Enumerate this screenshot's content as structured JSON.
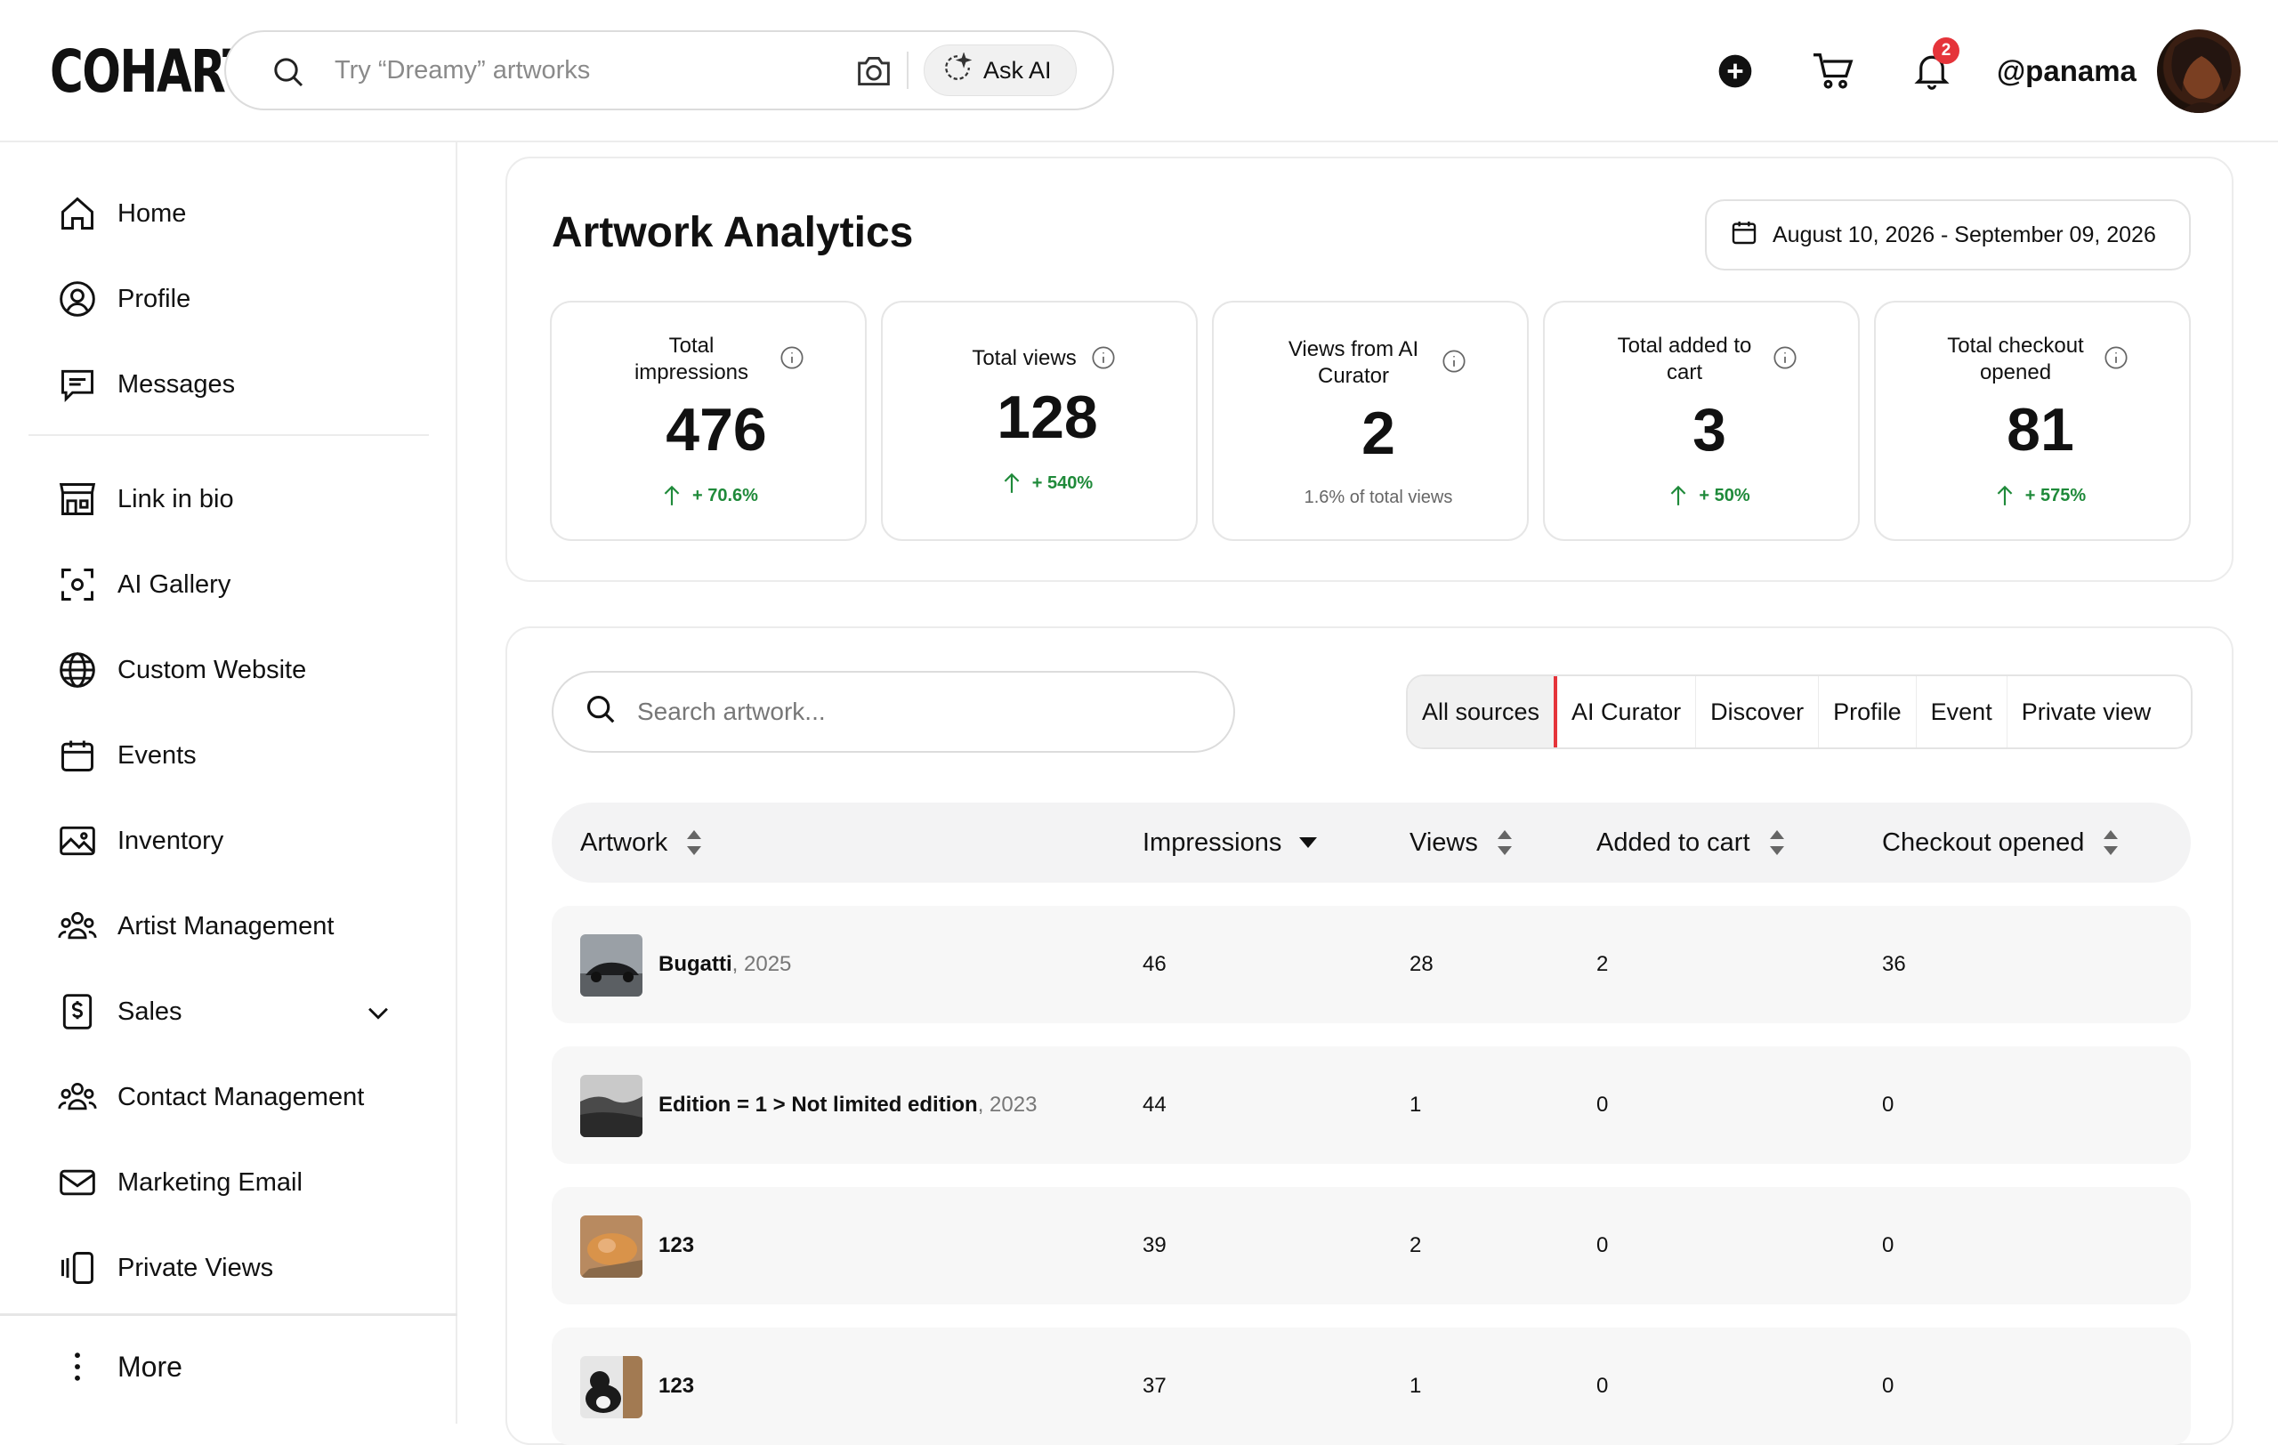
{
  "brand": {
    "logo": "COHART"
  },
  "search": {
    "placeholder": "Try “Dreamy” artworks",
    "ask_ai": "Ask AI"
  },
  "header": {
    "notification_count": "2",
    "username": "@panama"
  },
  "sidebar": {
    "items": [
      {
        "label": "Home",
        "icon": "home-icon"
      },
      {
        "label": "Profile",
        "icon": "user-circle-icon"
      },
      {
        "label": "Messages",
        "icon": "message-icon"
      },
      {
        "label": "Link in bio",
        "icon": "storefront-icon"
      },
      {
        "label": "AI Gallery",
        "icon": "scan-icon"
      },
      {
        "label": "Custom Website",
        "icon": "globe-icon"
      },
      {
        "label": "Events",
        "icon": "calendar-icon"
      },
      {
        "label": "Inventory",
        "icon": "image-icon"
      },
      {
        "label": "Artist Management",
        "icon": "users-icon"
      },
      {
        "label": "Sales",
        "icon": "dollar-icon"
      },
      {
        "label": "Contact Management",
        "icon": "users-icon"
      },
      {
        "label": "Marketing Email",
        "icon": "mail-icon"
      },
      {
        "label": "Private Views",
        "icon": "private-views-icon"
      }
    ],
    "more": "More"
  },
  "analytics": {
    "title": "Artwork Analytics",
    "date_range": "August 10, 2026 - September 09, 2026",
    "stats": [
      {
        "label_lines": [
          "Total",
          "impressions"
        ],
        "value": "476",
        "change": "+ 70.6%"
      },
      {
        "label_lines": [
          "Total views"
        ],
        "value": "128",
        "change": "+ 540%"
      },
      {
        "label_lines": [
          "Views from AI",
          "Curator"
        ],
        "value": "2",
        "sub": "1.6% of total views"
      },
      {
        "label_lines": [
          "Total added to",
          "cart"
        ],
        "value": "3",
        "change": "+ 50%"
      },
      {
        "label_lines": [
          "Total checkout",
          "opened"
        ],
        "value": "81",
        "change": "+ 575%"
      }
    ]
  },
  "table": {
    "search_placeholder": "Search artwork...",
    "sources": [
      "All sources",
      "AI Curator",
      "Discover",
      "Profile",
      "Event",
      "Private view"
    ],
    "active_source": "All sources",
    "columns": [
      "Artwork",
      "Impressions",
      "Views",
      "Added to cart",
      "Checkout opened"
    ],
    "rows": [
      {
        "name": "Bugatti",
        "year": ", 2025",
        "impressions": "46",
        "views": "28",
        "added": "2",
        "checkout": "36"
      },
      {
        "name": "Edition = 1 > Not limited edition",
        "year": ", 2023",
        "impressions": "44",
        "views": "1",
        "added": "0",
        "checkout": "0"
      },
      {
        "name": "123",
        "year": "",
        "impressions": "39",
        "views": "2",
        "added": "0",
        "checkout": "0"
      },
      {
        "name": "123",
        "year": "",
        "impressions": "37",
        "views": "1",
        "added": "0",
        "checkout": "0"
      }
    ]
  },
  "colors": {
    "accent_red": "#e5343a",
    "positive_green": "#1f8a3a"
  }
}
